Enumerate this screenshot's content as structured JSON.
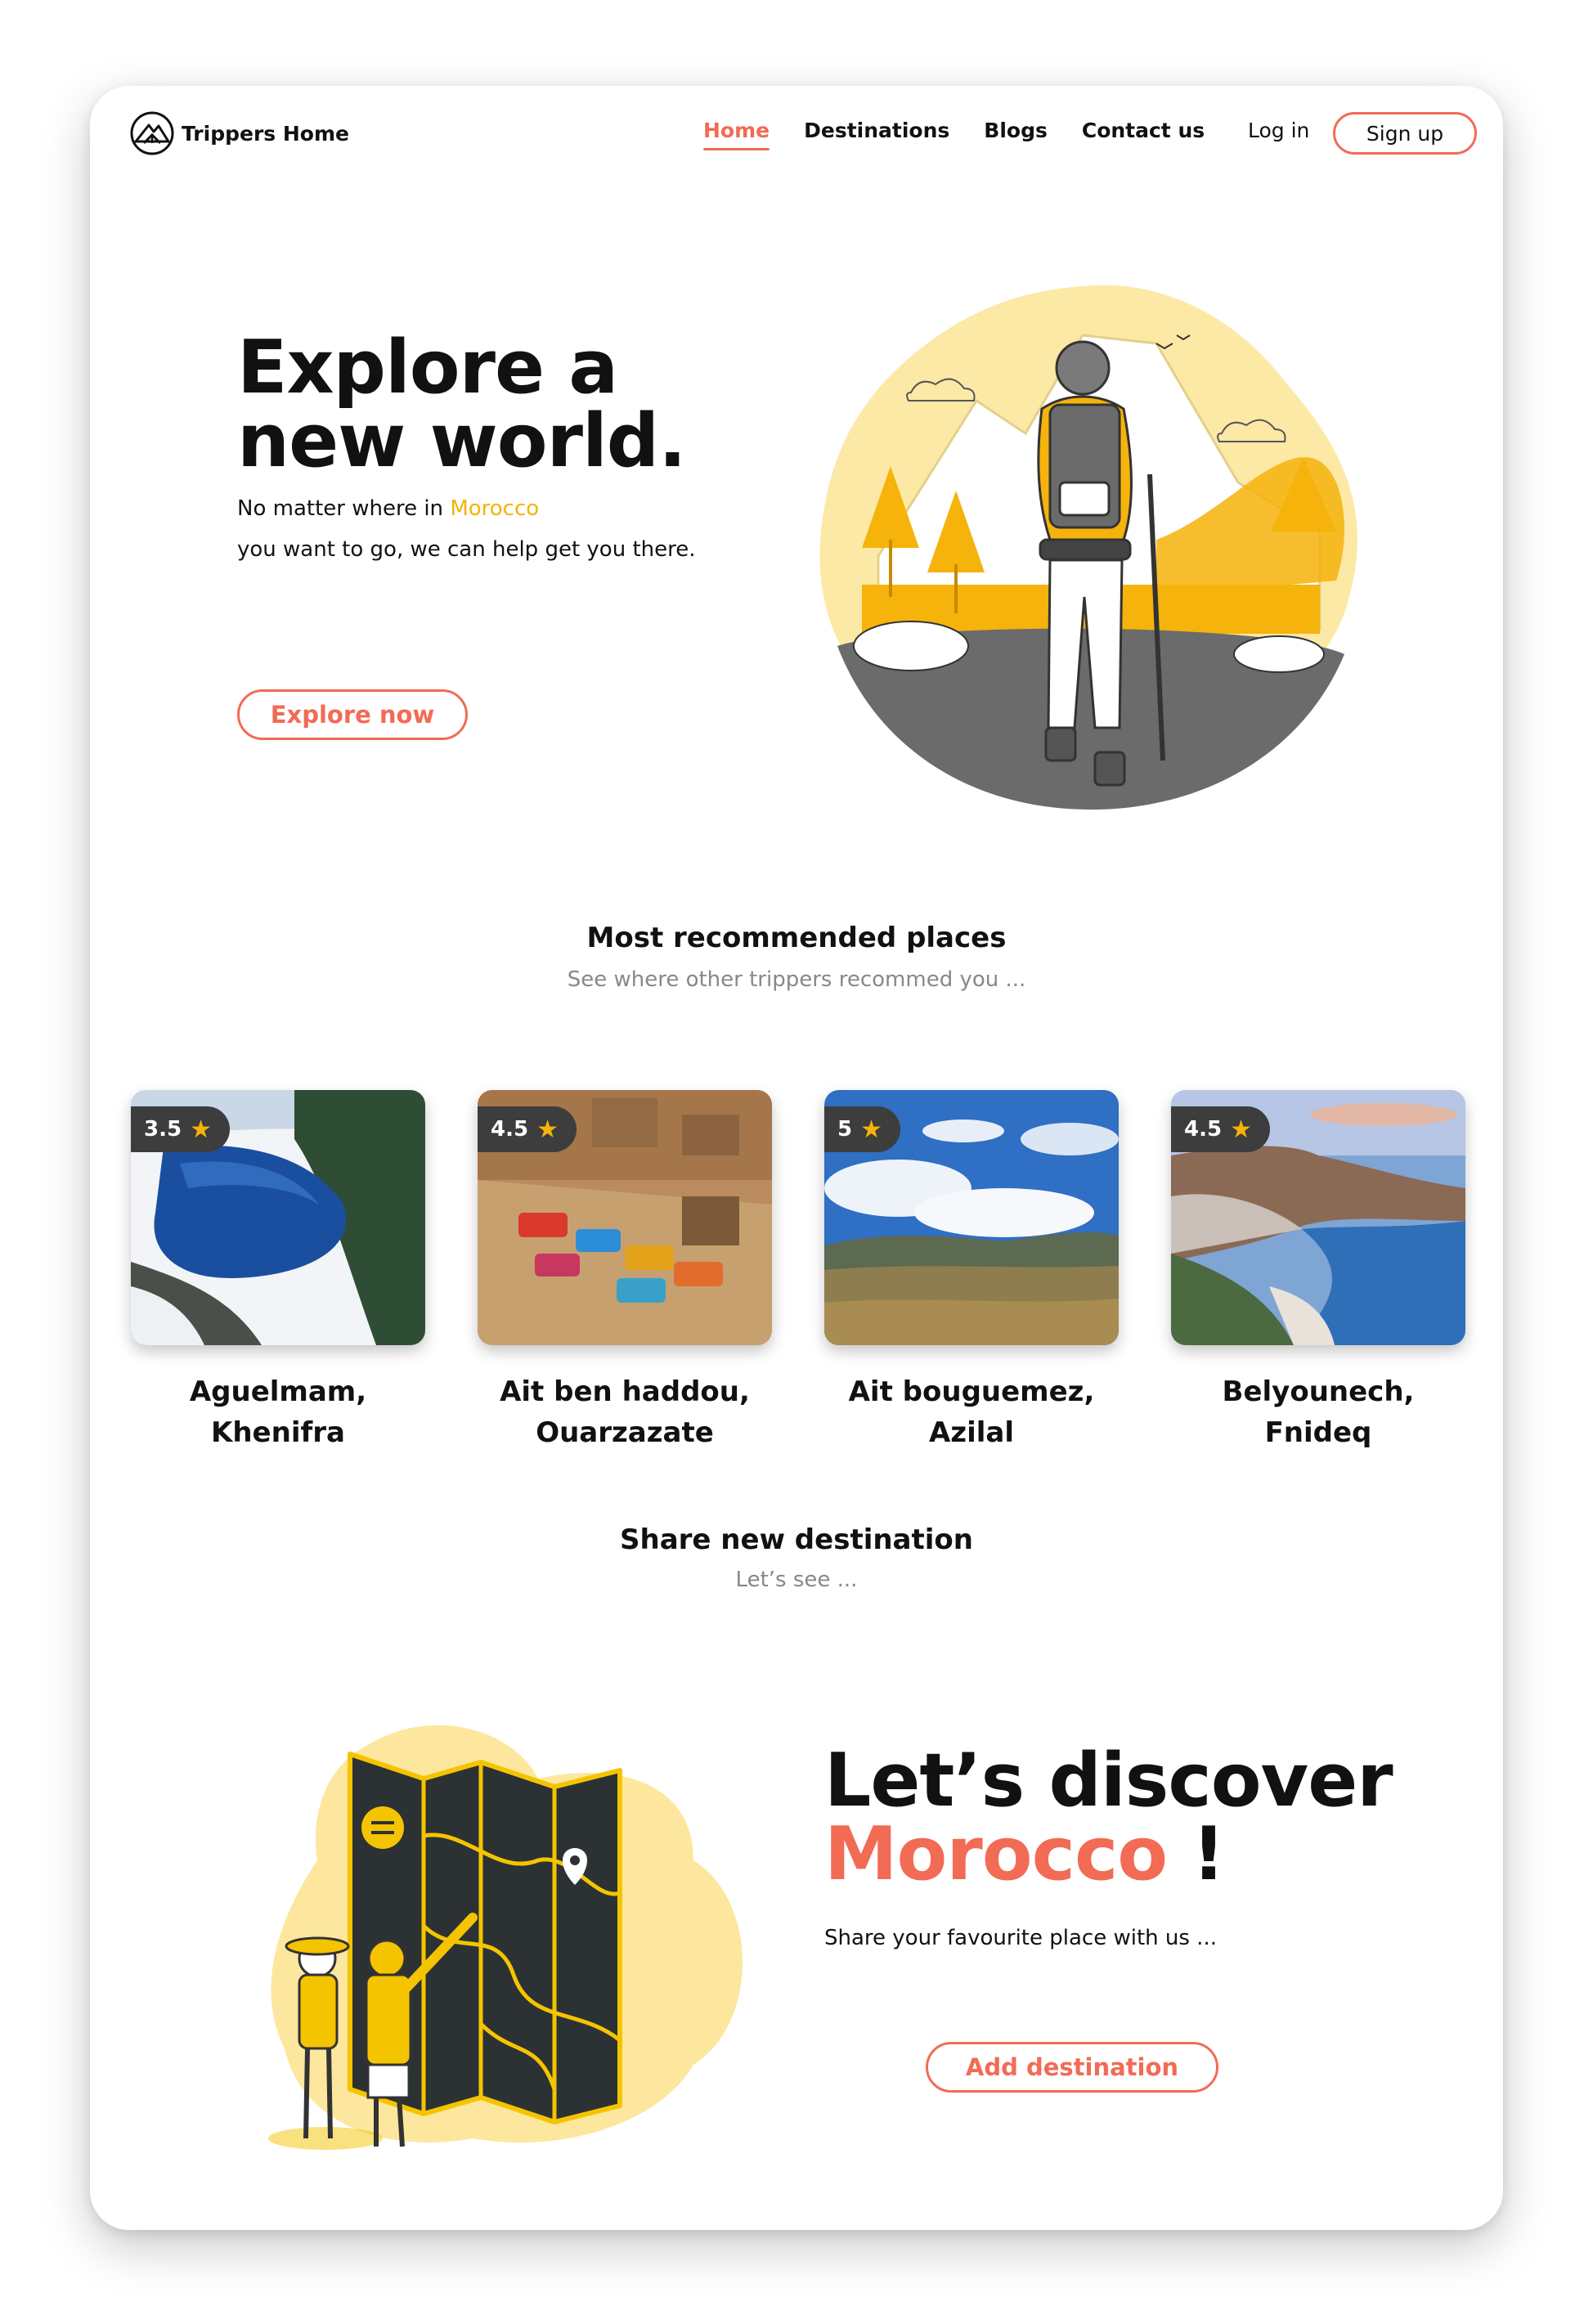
{
  "brand": {
    "name": "Trippers Home",
    "logo_icon": "mountain-tent-icon"
  },
  "nav": {
    "items": [
      {
        "label": "Home",
        "active": true
      },
      {
        "label": "Destinations",
        "active": false
      },
      {
        "label": "Blogs",
        "active": false
      },
      {
        "label": "Contact us",
        "active": false
      }
    ],
    "login": "Log in",
    "signup": "Sign up"
  },
  "hero": {
    "title_line1": "Explore a",
    "title_line2": "new world.",
    "subtitle_prefix": "No matter where in ",
    "subtitle_accent": "Morocco",
    "subtitle_line2": "you want to go, we can help get you there.",
    "cta": "Explore now",
    "illustration": "hiker-mountain-illustration"
  },
  "recommended": {
    "title": "Most recommended places",
    "subtitle": "See where other trippers recommed you ...",
    "places": [
      {
        "rating": "3.5",
        "name_line1": "Aguelmam,",
        "name_line2": "Khenifra",
        "image": "lake-photo"
      },
      {
        "rating": "4.5",
        "name_line1": "Ait ben haddou,",
        "name_line2": "Ouarzazate",
        "image": "kasbah-rooftop-photo"
      },
      {
        "rating": "5",
        "name_line1": "Ait bouguemez,",
        "name_line2": "Azilal",
        "image": "valley-sky-photo"
      },
      {
        "rating": "4.5",
        "name_line1": "Belyounech,",
        "name_line2": "Fnideq",
        "image": "coast-town-photo"
      }
    ]
  },
  "share": {
    "title": "Share new destination",
    "subtitle": "Let’s see ...",
    "heading_line1": "Let’s discover",
    "heading_accent": "Morocco",
    "heading_mark": " !",
    "text": "Share your favourite place with us ...",
    "cta": "Add destination",
    "illustration": "map-travelers-illustration"
  },
  "colors": {
    "accent": "#f26b55",
    "yellow": "#f5b30b",
    "dark": "#2c3134"
  }
}
